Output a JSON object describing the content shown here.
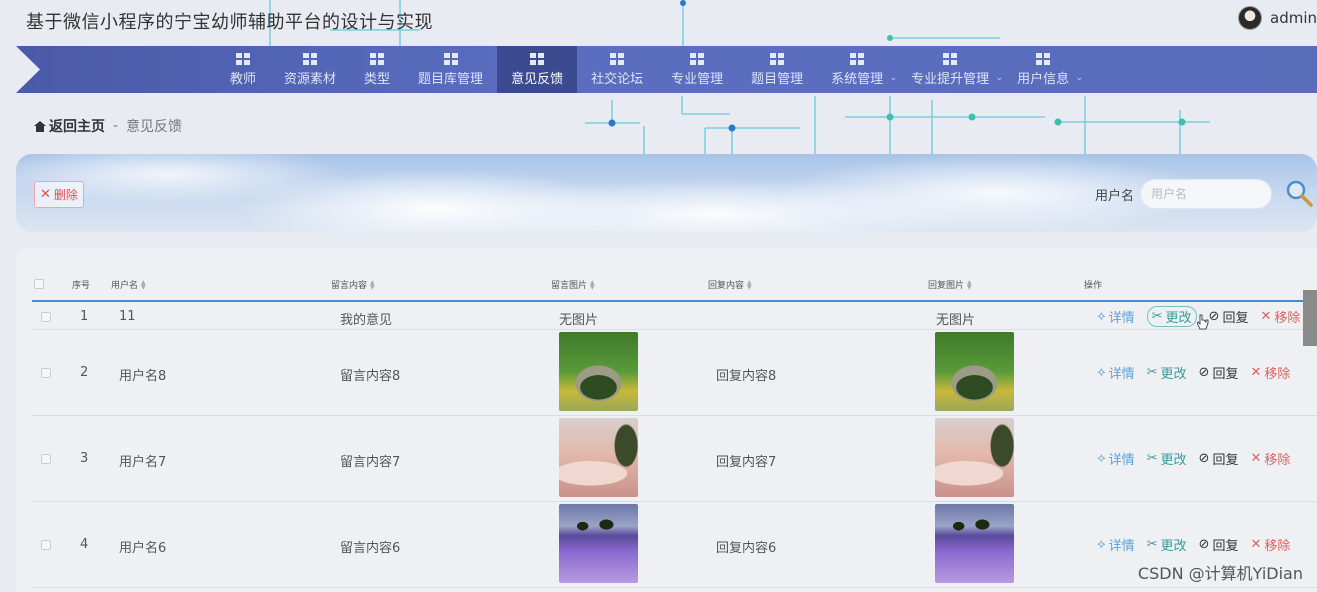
{
  "app": {
    "title": "基于微信小程序的宁宝幼师辅助平台的设计与实现",
    "user": "admin"
  },
  "nav": {
    "items": [
      {
        "label": "教师",
        "active": false,
        "caret": false
      },
      {
        "label": "资源素材",
        "active": false,
        "caret": false
      },
      {
        "label": "类型",
        "active": false,
        "caret": false
      },
      {
        "label": "题目库管理",
        "active": false,
        "caret": false
      },
      {
        "label": "意见反馈",
        "active": true,
        "caret": false
      },
      {
        "label": "社交论坛",
        "active": false,
        "caret": false
      },
      {
        "label": "专业管理",
        "active": false,
        "caret": false
      },
      {
        "label": "题目管理",
        "active": false,
        "caret": false
      },
      {
        "label": "系统管理",
        "active": false,
        "caret": true
      },
      {
        "label": "专业提升管理",
        "active": false,
        "caret": true
      },
      {
        "label": "用户信息",
        "active": false,
        "caret": true
      }
    ]
  },
  "breadcrumb": {
    "home": "返回主页",
    "sep": "-",
    "current": "意见反馈"
  },
  "actions": {
    "delete": "删除"
  },
  "search": {
    "label": "用户名",
    "placeholder": "用户名"
  },
  "table": {
    "headers": {
      "index": "序号",
      "username": "用户名",
      "content": "留言内容",
      "image": "留言图片",
      "reply": "回复内容",
      "reply_image": "回复图片",
      "ops": "操作"
    },
    "ops": {
      "detail": "详情",
      "edit": "更改",
      "reply": "回复",
      "remove": "移除"
    },
    "no_image": "无图片",
    "rows": [
      {
        "index": "1",
        "username": "11",
        "content": "我的意见",
        "image": "",
        "reply": "",
        "reply_image": ""
      },
      {
        "index": "2",
        "username": "用户名8",
        "content": "留言内容8",
        "image": "bridge",
        "reply": "回复内容8",
        "reply_image": "bridge"
      },
      {
        "index": "3",
        "username": "用户名7",
        "content": "留言内容7",
        "image": "fog",
        "reply": "回复内容7",
        "reply_image": "fog"
      },
      {
        "index": "4",
        "username": "用户名6",
        "content": "留言内容6",
        "image": "lavender",
        "reply": "回复内容6",
        "reply_image": "lavender"
      }
    ]
  },
  "watermark": "CSDN @计算机YiDian",
  "colors": {
    "nav_bg": "#5a6dc0",
    "nav_active": "#3c4a8f",
    "accent_line": "#3d8fdc",
    "danger": "#e05050"
  }
}
